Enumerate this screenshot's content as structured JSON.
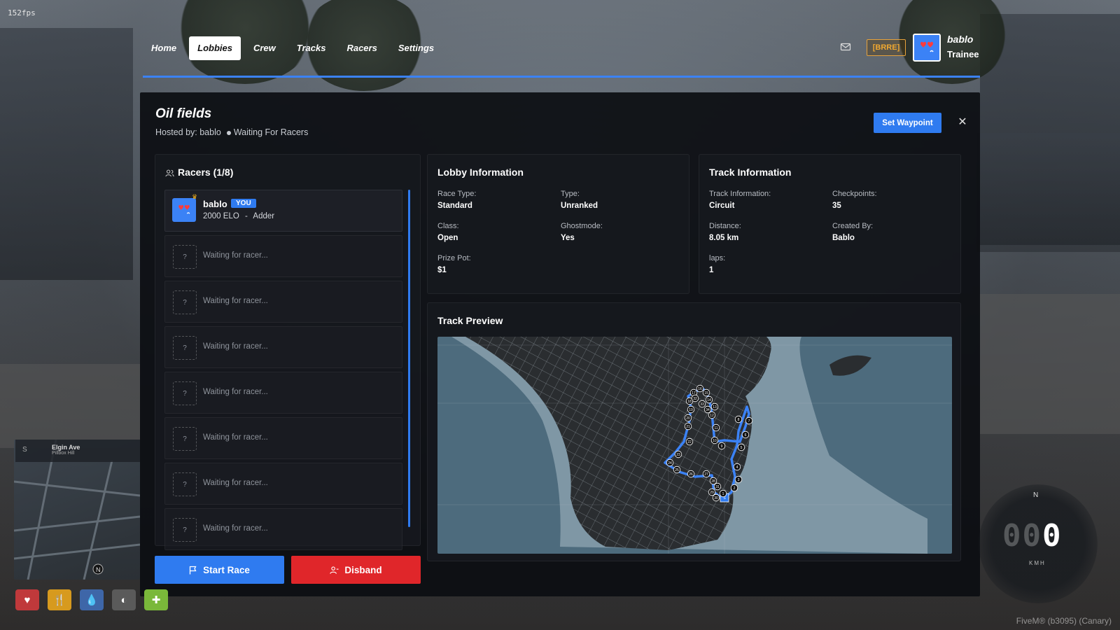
{
  "hud": {
    "fps": "152fps",
    "client": "FiveM® (b3095) (Canary)",
    "street": "Elgin Ave",
    "district": "Pillbox Hill",
    "compass": "S",
    "speed_ghost": "00",
    "speed": "0",
    "speed_unit": "KMH",
    "speedo_heading": "N",
    "minimap_north": "N"
  },
  "nav": {
    "items": [
      "Home",
      "Lobbies",
      "Crew",
      "Tracks",
      "Racers",
      "Settings"
    ],
    "active": "Lobbies",
    "tag": "[BRRE]",
    "user": {
      "name": "bablo",
      "rank": "Trainee"
    }
  },
  "lobby": {
    "title": "Oil fields",
    "hosted_by": "Hosted by: bablo",
    "status": "Waiting For Racers",
    "waypoint_label": "Set Waypoint",
    "close_label": "✕"
  },
  "racers": {
    "title": "Racers (1/8)",
    "filled": [
      {
        "name": "bablo",
        "badge": "YOU",
        "elo": "2000 ELO",
        "separator": "-",
        "car": "Adder"
      }
    ],
    "empty_label": "Waiting for racer...",
    "empty_icon": "?",
    "empty_count": 7
  },
  "lobby_info": {
    "title": "Lobby Information",
    "fields": [
      {
        "label": "Race Type:",
        "value": "Standard"
      },
      {
        "label": "Type:",
        "value": "Unranked"
      },
      {
        "label": "Class:",
        "value": "Open"
      },
      {
        "label": "Ghostmode:",
        "value": "Yes"
      },
      {
        "label": "Prize Pot:",
        "value": "$1"
      }
    ]
  },
  "track_info": {
    "title": "Track Information",
    "fields": [
      {
        "label": "Track Information:",
        "value": "Circuit"
      },
      {
        "label": "Checkpoints:",
        "value": "35"
      },
      {
        "label": "Distance:",
        "value": "8.05 km"
      },
      {
        "label": "Created By:",
        "value": "Bablo"
      },
      {
        "label": "laps:",
        "value": "1"
      }
    ]
  },
  "preview": {
    "title": "Track Preview",
    "checkpoints": [
      "S",
      "1",
      "2",
      "3",
      "4",
      "5",
      "6",
      "7",
      "8",
      "9",
      "10",
      "11",
      "12",
      "13",
      "14",
      "15",
      "16",
      "17",
      "18",
      "19",
      "20",
      "21",
      "22",
      "23",
      "24",
      "25",
      "26",
      "27",
      "28",
      "29",
      "30",
      "31",
      "32",
      "33",
      "34"
    ]
  },
  "actions": {
    "start_label": "Start Race",
    "disband_label": "Disband"
  },
  "colors": {
    "accent": "#2f7bf0",
    "danger": "#e0262a",
    "tag": "#f0a830"
  }
}
